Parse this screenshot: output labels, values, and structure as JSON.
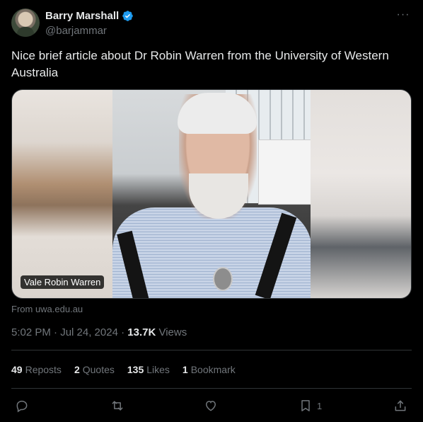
{
  "author": {
    "name": "Barry Marshall",
    "handle": "@barjammar",
    "verified": true,
    "verified_icon": "verified-badge-icon",
    "verified_color": "#1d9bf0"
  },
  "more_icon": "more-icon",
  "more_label": "···",
  "tweet": {
    "text": "Nice brief article about Dr Robin Warren from the University of Western Australia"
  },
  "media": {
    "caption_label": "Vale Robin Warren",
    "source": "From uwa.edu.au"
  },
  "meta": {
    "time": "5:02 PM · Jul 24, 2024 · ",
    "views_count": "13.7K",
    "views_label": " Views"
  },
  "stats": {
    "reposts_count": "49",
    "reposts_label": "Reposts",
    "quotes_count": "2",
    "quotes_label": "Quotes",
    "likes_count": "135",
    "likes_label": "Likes",
    "bookmarks_count": "1",
    "bookmarks_label": "Bookmark"
  },
  "actions": {
    "reply_icon": "reply-icon",
    "repost_icon": "repost-icon",
    "like_icon": "like-icon",
    "bookmark_icon": "bookmark-icon",
    "bookmark_count": "1",
    "share_icon": "share-icon"
  },
  "colors": {
    "background": "#000000",
    "text": "#e7e9ea",
    "secondary": "#71767b",
    "divider": "#2f3336"
  }
}
